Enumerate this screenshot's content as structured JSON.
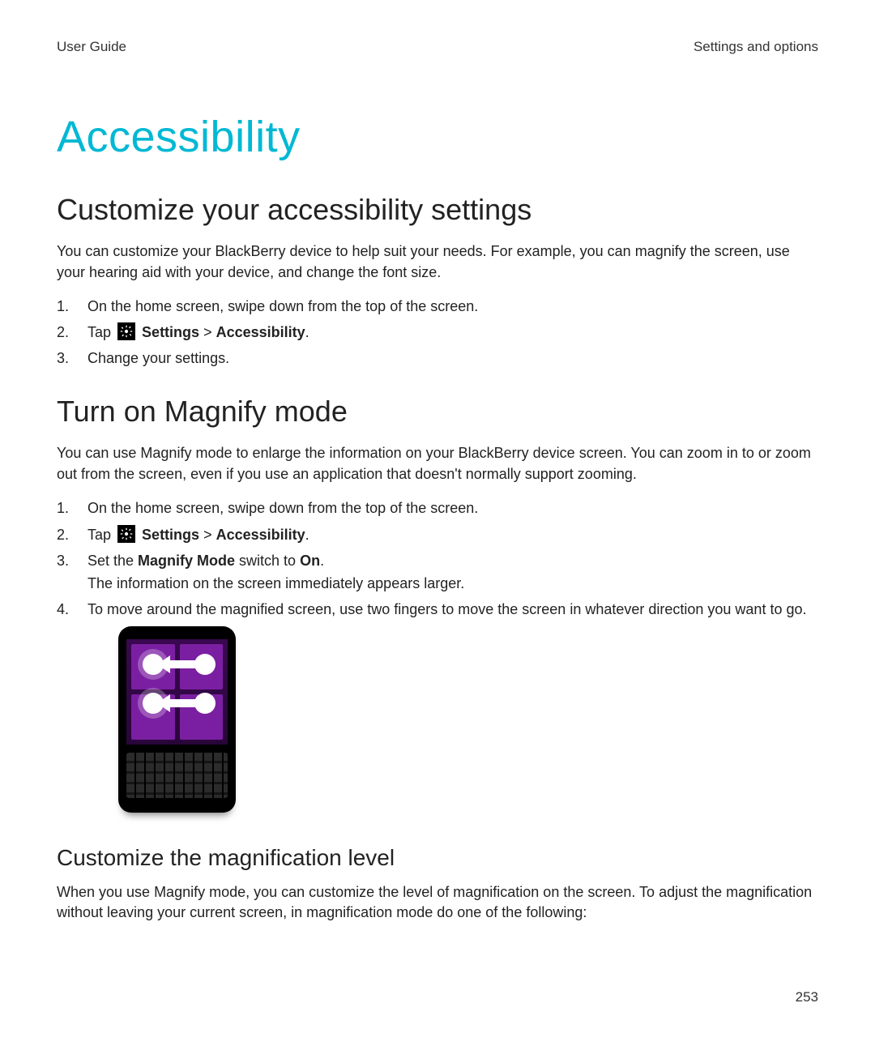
{
  "header": {
    "left": "User Guide",
    "right": "Settings and options"
  },
  "title": "Accessibility",
  "section1": {
    "heading": "Customize your accessibility settings",
    "intro": "You can customize your BlackBerry device to help suit your needs. For example, you can magnify the screen, use your hearing aid with your device, and change the font size.",
    "steps": {
      "s1_num": "1.",
      "s1": "On the home screen, swipe down from the top of the screen.",
      "s2_num": "2.",
      "s2_tap": "Tap ",
      "s2_settings": "Settings",
      "s2_gt": " > ",
      "s2_accessibility": "Accessibility",
      "s2_period": ".",
      "s3_num": "3.",
      "s3": "Change your settings."
    }
  },
  "section2": {
    "heading": "Turn on Magnify mode",
    "intro": "You can use Magnify mode to enlarge the information on your BlackBerry device screen. You can zoom in to or zoom out from the screen, even if you use an application that doesn't normally support zooming.",
    "steps": {
      "s1_num": "1.",
      "s1": "On the home screen, swipe down from the top of the screen.",
      "s2_num": "2.",
      "s2_tap": "Tap ",
      "s2_settings": "Settings",
      "s2_gt": " > ",
      "s2_accessibility": "Accessibility",
      "s2_period": ".",
      "s3_num": "3.",
      "s3_pre": "Set the ",
      "s3_magnify": "Magnify Mode",
      "s3_mid": " switch to ",
      "s3_on": "On",
      "s3_period": ".",
      "s3_sub": "The information on the screen immediately appears larger.",
      "s4_num": "4.",
      "s4": "To move around the magnified screen, use two fingers to move the screen in whatever direction you want to go."
    }
  },
  "section3": {
    "heading": "Customize the magnification level",
    "intro": "When you use Magnify mode, you can customize the level of magnification on the screen. To adjust the magnification without leaving your current screen, in magnification mode do one of the following:"
  },
  "page_number": "253",
  "icons": {
    "gear": "gear-icon"
  }
}
